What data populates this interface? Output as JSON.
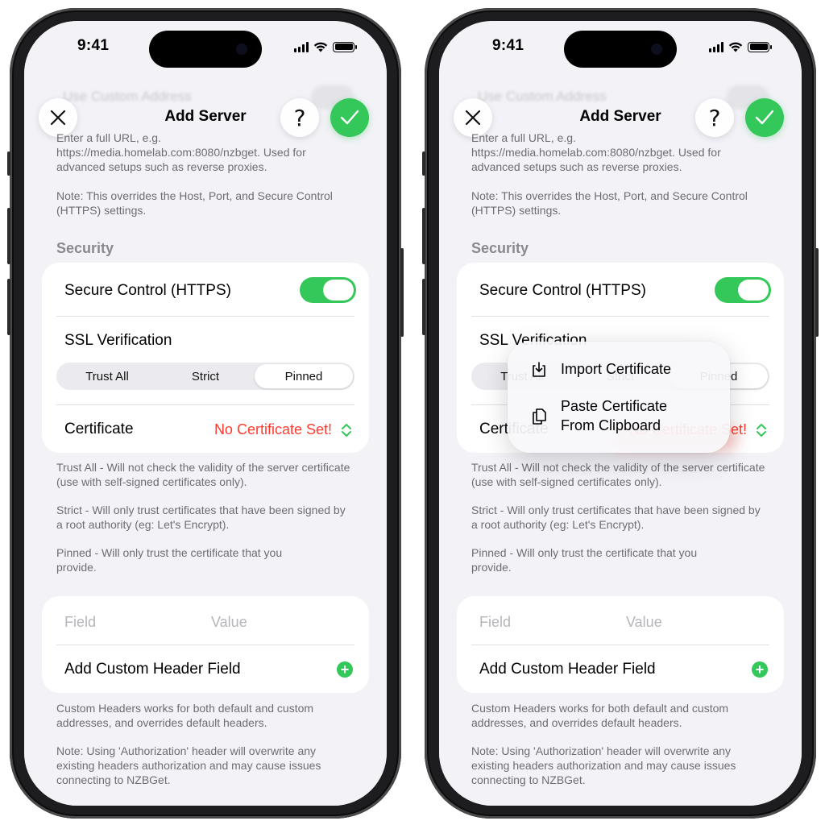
{
  "status": {
    "time": "9:41"
  },
  "faded_row": {
    "label": "Use Custom Address"
  },
  "nav": {
    "title": "Add Server",
    "close_icon": "xmark-icon",
    "help_label": "?",
    "done_icon": "checkmark-icon"
  },
  "custom_address": {
    "help": "Enter a full URL, e.g. https://media.homelab.com:8080/nzbget. Used for advanced setups such as reverse proxies.",
    "note": "Note: This overrides the Host, Port, and Secure Control (HTTPS) settings."
  },
  "security": {
    "header": "Security",
    "secure_control_label": "Secure Control (HTTPS)",
    "secure_control_on": true,
    "ssl_label": "SSL Verification",
    "segments": [
      "Trust All",
      "Strict",
      "Pinned"
    ],
    "selected_segment": "Pinned",
    "certificate_label": "Certificate",
    "certificate_value": "No Certificate Set!",
    "footer_trust_all": "Trust All - Will not check the validity of the server certificate (use with self-signed certificates only).",
    "footer_strict": "Strict - Will only trust certificates that have been signed by a root authority (eg: Let's Encrypt).",
    "footer_pinned": "Pinned - Will only trust the certificate that you provide."
  },
  "headers": {
    "field_placeholder": "Field",
    "value_placeholder": "Value",
    "add_label": "Add Custom Header Field",
    "footer_1": "Custom Headers works for both default and custom addresses, and overrides default headers.",
    "footer_2": "Note: Using 'Authorization' header will overwrite any existing headers authorization and may cause issues connecting to NZBGet."
  },
  "menu": {
    "import_label": "Import Certificate",
    "import_icon": "square-arrow-down-icon",
    "paste_label_line1": "Paste Certificate",
    "paste_label_line2": "From Clipboard",
    "paste_icon": "doc-on-doc-icon"
  },
  "colors": {
    "accent_green": "#34c759",
    "destructive_red": "#ff3b30",
    "background": "#f2f2f7"
  }
}
